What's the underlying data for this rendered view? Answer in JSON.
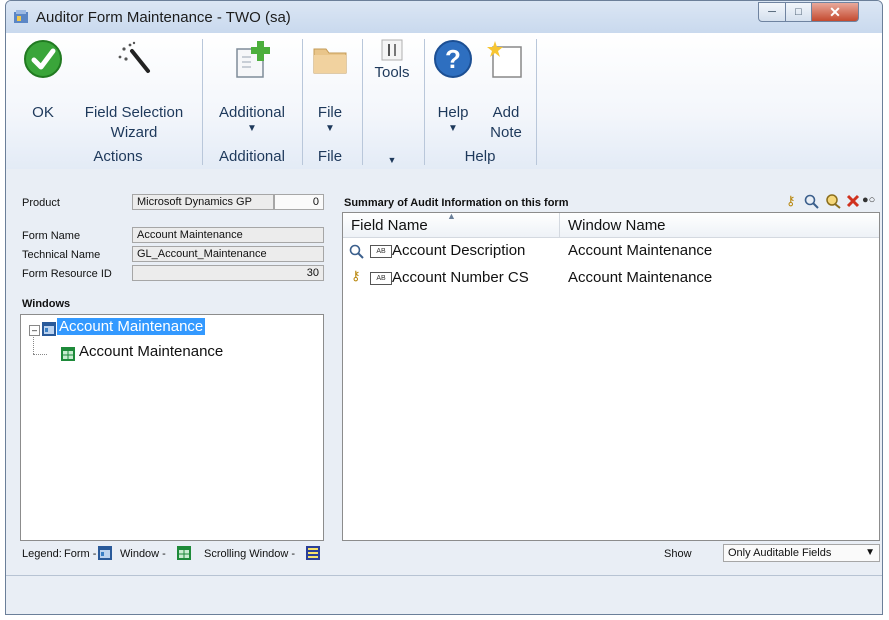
{
  "window": {
    "title": "Auditor Form Maintenance  -  TWO (sa)"
  },
  "ribbon": {
    "ok": "OK",
    "field_selection": [
      "Field Selection",
      "Wizard"
    ],
    "additional": "Additional",
    "file": "File",
    "tools": "Tools",
    "help": "Help",
    "add_note": [
      "Add",
      "Note"
    ],
    "groups": {
      "actions": "Actions",
      "additional": "Additional",
      "file": "File",
      "help": "Help"
    }
  },
  "form": {
    "product_label": "Product",
    "product_value": "Microsoft Dynamics GP",
    "product_id": "0",
    "form_name_label": "Form Name",
    "form_name_value": "Account Maintenance",
    "technical_name_label": "Technical Name",
    "technical_name_value": "GL_Account_Maintenance",
    "resource_id_label": "Form Resource ID",
    "resource_id_value": "30",
    "windows_label": "Windows"
  },
  "tree": {
    "root": "Account Maintenance",
    "child": "Account Maintenance"
  },
  "summary": {
    "title": "Summary of Audit Information on this form",
    "columns": [
      "Field Name",
      "Window Name"
    ],
    "rows": [
      {
        "field": "Account Description",
        "window": "Account Maintenance",
        "icon": "magnifier-icon"
      },
      {
        "field": "Account Number CS",
        "window": "Account Maintenance",
        "icon": "key-icon"
      }
    ]
  },
  "legend": {
    "label": "Legend:",
    "form": "Form -",
    "window": "Window -",
    "scrolling": "Scrolling Window -"
  },
  "show": {
    "label": "Show",
    "value": "Only Auditable Fields"
  },
  "colors": {
    "selection": "#3399ff",
    "accent": "#1e395b"
  }
}
